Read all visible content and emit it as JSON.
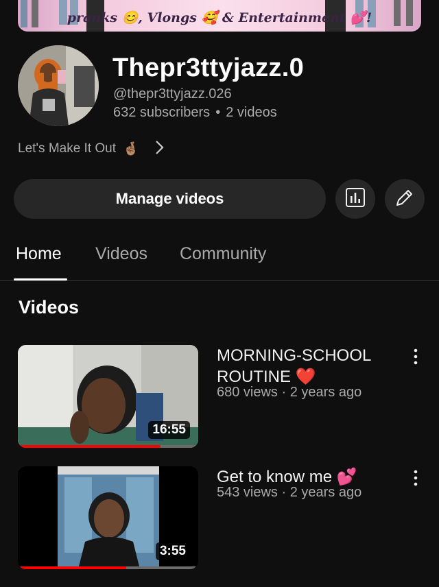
{
  "banner": {
    "tagline": "pranks 😊, Vlongs 🥰 & Entertainment 💕!"
  },
  "channel": {
    "name": "Thepr3ttyjazz.0",
    "handle": "@thepr3ttyjazz.026",
    "subscribers": "632 subscribers",
    "separator": "•",
    "video_count": "2 videos",
    "description": "Let's Make It Out",
    "description_emoji": "🤞🏽"
  },
  "actions": {
    "manage_label": "Manage videos",
    "analytics_icon": "analytics-icon",
    "edit_icon": "pencil-icon"
  },
  "tabs": [
    {
      "label": "Home",
      "active": true
    },
    {
      "label": "Videos",
      "active": false
    },
    {
      "label": "Community",
      "active": false
    }
  ],
  "section": {
    "title": "Videos"
  },
  "videos": [
    {
      "title": "MORNING-SCHOOL ROUTINE ❤️",
      "views": "680 views",
      "age": "2 years ago",
      "meta_separator": "·",
      "duration": "16:55",
      "watched_fraction": 0.79
    },
    {
      "title": "Get to know me 💕",
      "views": "543 views",
      "age": "2 years ago",
      "meta_separator": "·",
      "duration": "3:55",
      "watched_fraction": 0.6
    }
  ],
  "colors": {
    "background": "#0f0f0f",
    "button": "#272727",
    "secondary_text": "#aaaaaa",
    "progress": "#ff0000"
  }
}
